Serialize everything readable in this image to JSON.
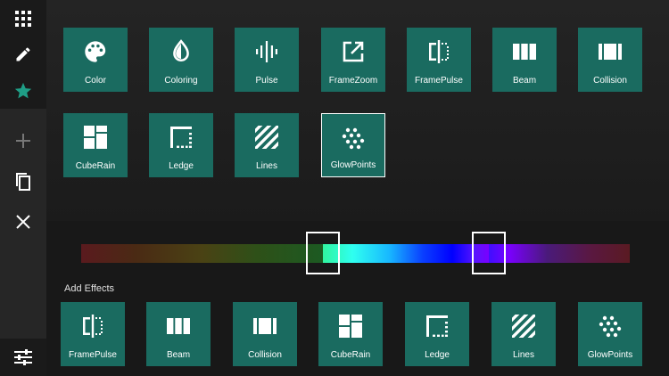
{
  "sidebar": {
    "buttons": [
      {
        "name": "grid-icon"
      },
      {
        "name": "pencil-icon"
      },
      {
        "name": "star-icon"
      },
      {
        "name": "plus-icon"
      },
      {
        "name": "copy-icon"
      },
      {
        "name": "close-icon"
      },
      {
        "name": "sliders-icon"
      }
    ]
  },
  "effects": [
    {
      "label": "Color",
      "icon": "palette-icon"
    },
    {
      "label": "Coloring",
      "icon": "drop-icon"
    },
    {
      "label": "Pulse",
      "icon": "waveform-icon"
    },
    {
      "label": "FrameZoom",
      "icon": "open-in-new-icon"
    },
    {
      "label": "FramePulse",
      "icon": "frame-pulse-icon"
    },
    {
      "label": "Beam",
      "icon": "beam-icon"
    },
    {
      "label": "Collision",
      "icon": "collision-icon"
    },
    {
      "label": "CubeRain",
      "icon": "cube-rain-icon"
    },
    {
      "label": "Ledge",
      "icon": "ledge-icon"
    },
    {
      "label": "Lines",
      "icon": "diagonal-lines-icon"
    },
    {
      "label": "GlowPoints",
      "icon": "glow-points-icon",
      "selected": true
    }
  ],
  "range": {
    "start": 0.44,
    "end": 0.74
  },
  "add_effects": {
    "label": "Add Effects",
    "items": [
      {
        "label": "FramePulse",
        "icon": "frame-pulse-icon"
      },
      {
        "label": "Beam",
        "icon": "beam-icon"
      },
      {
        "label": "Collision",
        "icon": "collision-icon"
      },
      {
        "label": "CubeRain",
        "icon": "cube-rain-icon"
      },
      {
        "label": "Ledge",
        "icon": "ledge-icon"
      },
      {
        "label": "Lines",
        "icon": "diagonal-lines-icon"
      },
      {
        "label": "GlowPoints",
        "icon": "glow-points-icon"
      }
    ]
  },
  "colors": {
    "tile": "#1a6b60",
    "accent": "#1f9e86"
  }
}
